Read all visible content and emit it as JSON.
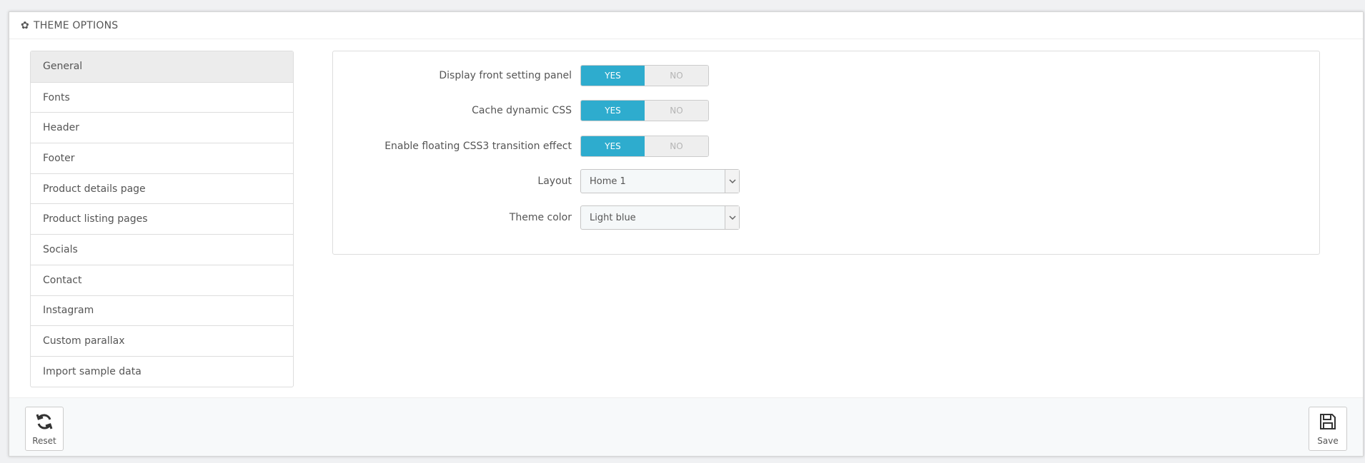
{
  "panel": {
    "title": "THEME OPTIONS",
    "icon": "gear-icon"
  },
  "sidebar": {
    "items": [
      {
        "label": "General"
      },
      {
        "label": "Fonts"
      },
      {
        "label": "Header"
      },
      {
        "label": "Footer"
      },
      {
        "label": "Product details page"
      },
      {
        "label": "Product listing pages"
      },
      {
        "label": "Socials"
      },
      {
        "label": "Contact"
      },
      {
        "label": "Instagram"
      },
      {
        "label": "Custom parallax"
      },
      {
        "label": "Import sample data"
      }
    ]
  },
  "form": {
    "display_front_setting_panel": {
      "label": "Display front setting panel",
      "yes": "YES",
      "no": "NO",
      "value": "YES"
    },
    "cache_dynamic_css": {
      "label": "Cache dynamic CSS",
      "yes": "YES",
      "no": "NO",
      "value": "YES"
    },
    "enable_floating_css3": {
      "label": "Enable floating CSS3 transition effect",
      "yes": "YES",
      "no": "NO",
      "value": "YES"
    },
    "layout": {
      "label": "Layout",
      "value": "Home 1"
    },
    "theme_color": {
      "label": "Theme color",
      "value": "Light blue"
    }
  },
  "footer": {
    "reset_label": "Reset",
    "save_label": "Save"
  },
  "colors": {
    "accent": "#2eacce",
    "border": "#dddddd"
  }
}
